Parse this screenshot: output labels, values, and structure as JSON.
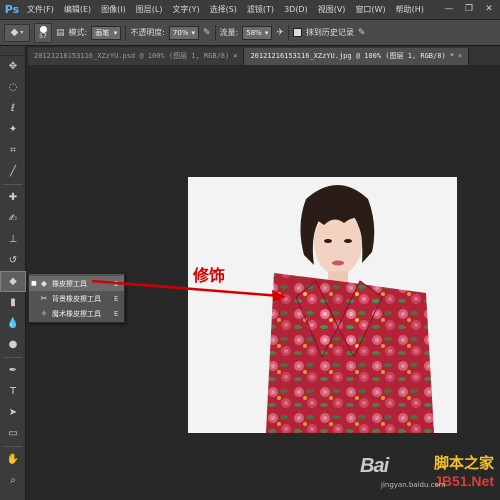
{
  "app": {
    "logo": "Ps"
  },
  "menu": [
    "文件(F)",
    "编辑(E)",
    "图像(I)",
    "图层(L)",
    "文字(Y)",
    "选择(S)",
    "滤镜(T)",
    "3D(D)",
    "视图(V)",
    "窗口(W)",
    "帮助(H)"
  ],
  "window_controls": [
    "—",
    "❐",
    "✕"
  ],
  "options": {
    "brush_size": "57",
    "mode_label": "模式:",
    "mode_value": "画笔",
    "opacity_label": "不透明度:",
    "opacity_value": "70%",
    "flow_label": "流量:",
    "flow_value": "58%",
    "erase_history_label": "抹到历史记录"
  },
  "tabs": [
    {
      "label": "20121216153116_XZzYU.psd @ 100% (图层 1, RGB/8)",
      "active": false
    },
    {
      "label": "20121216153116_XZzYU.jpg @ 100% (图层 1, RGB/8) *",
      "active": true
    }
  ],
  "flyout": {
    "items": [
      {
        "label": "橡皮擦工具",
        "key": "E",
        "selected": true
      },
      {
        "label": "背景橡皮擦工具",
        "key": "E",
        "selected": false
      },
      {
        "label": "魔术橡皮擦工具",
        "key": "E",
        "selected": false
      }
    ]
  },
  "annotation": {
    "label": "修饰",
    "color": "#d40000"
  },
  "watermark": {
    "baidu": "Bai",
    "jb_cn": "脚本之家",
    "jb_net": "JB51.Net",
    "url": "jingyan.baidu.com"
  },
  "colors": {
    "menubar": "#3c3c3c",
    "optbar": "#4a4a4a",
    "workspace": "#282828",
    "accent": "#5cb3ff"
  }
}
